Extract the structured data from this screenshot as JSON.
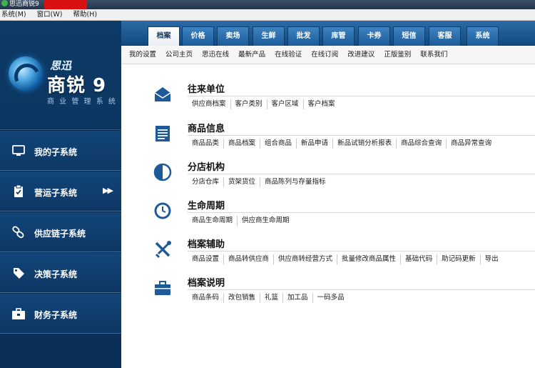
{
  "window": {
    "title": "思迅商锐9"
  },
  "menubar": {
    "items": [
      "系统(M)",
      "窗口(W)",
      "帮助(H)"
    ]
  },
  "brand": {
    "small": "思迅",
    "big": "商锐 9",
    "sub": "商 业 管 理 系 统"
  },
  "sidebar": {
    "items": [
      {
        "label": "我的子系统",
        "icon": "monitor-icon"
      },
      {
        "label": "营运子系统",
        "icon": "clipboard-icon",
        "arrow": "▶▶"
      },
      {
        "label": "供应链子系统",
        "icon": "link-icon"
      },
      {
        "label": "决策子系统",
        "icon": "tag-icon"
      },
      {
        "label": "财务子系统",
        "icon": "briefcase-icon"
      }
    ]
  },
  "tabs": [
    "档案",
    "价格",
    "卖场",
    "生鲜",
    "批发",
    "库管",
    "卡券",
    "短信",
    "客服",
    "系统"
  ],
  "active_tab": "档案",
  "linkbar": [
    "我的设置",
    "公司主页",
    "思迅在线",
    "最新产品",
    "在线验证",
    "在线订阅",
    "改进建议",
    "正版鉴别",
    "联系我们"
  ],
  "sections": [
    {
      "title": "往来单位",
      "icon": "envelope-icon",
      "items": [
        "供应商档案",
        "客户类别",
        "客户区域",
        "客户档案"
      ]
    },
    {
      "title": "商品信息",
      "icon": "document-icon",
      "items": [
        "商品品类",
        "商品档案",
        "组合商品",
        "新品申请",
        "新品试销分析报表",
        "商品综合查询",
        "商品异常查询"
      ]
    },
    {
      "title": "分店机构",
      "icon": "half-circle-icon",
      "items": [
        "分店仓库",
        "货架货位",
        "商品陈列与存量指标"
      ]
    },
    {
      "title": "生命周期",
      "icon": "clock-icon",
      "items": [
        "商品生命周期",
        "供应商生命周期"
      ]
    },
    {
      "title": "档案辅助",
      "icon": "tools-icon",
      "items": [
        "商品设置",
        "商品转供应商",
        "供应商转经营方式",
        "批量修改商品属性",
        "基础代码",
        "助记码更新",
        "导出"
      ]
    },
    {
      "title": "档案说明",
      "icon": "toolbox-icon",
      "items": [
        "商品条码",
        "改包销售",
        "礼篮",
        "加工品",
        "一码多品"
      ]
    }
  ],
  "colors": {
    "sidebar": "#0d3a66",
    "tabbar": "#1b5b98",
    "icon_blue": "#1e5a9a"
  }
}
